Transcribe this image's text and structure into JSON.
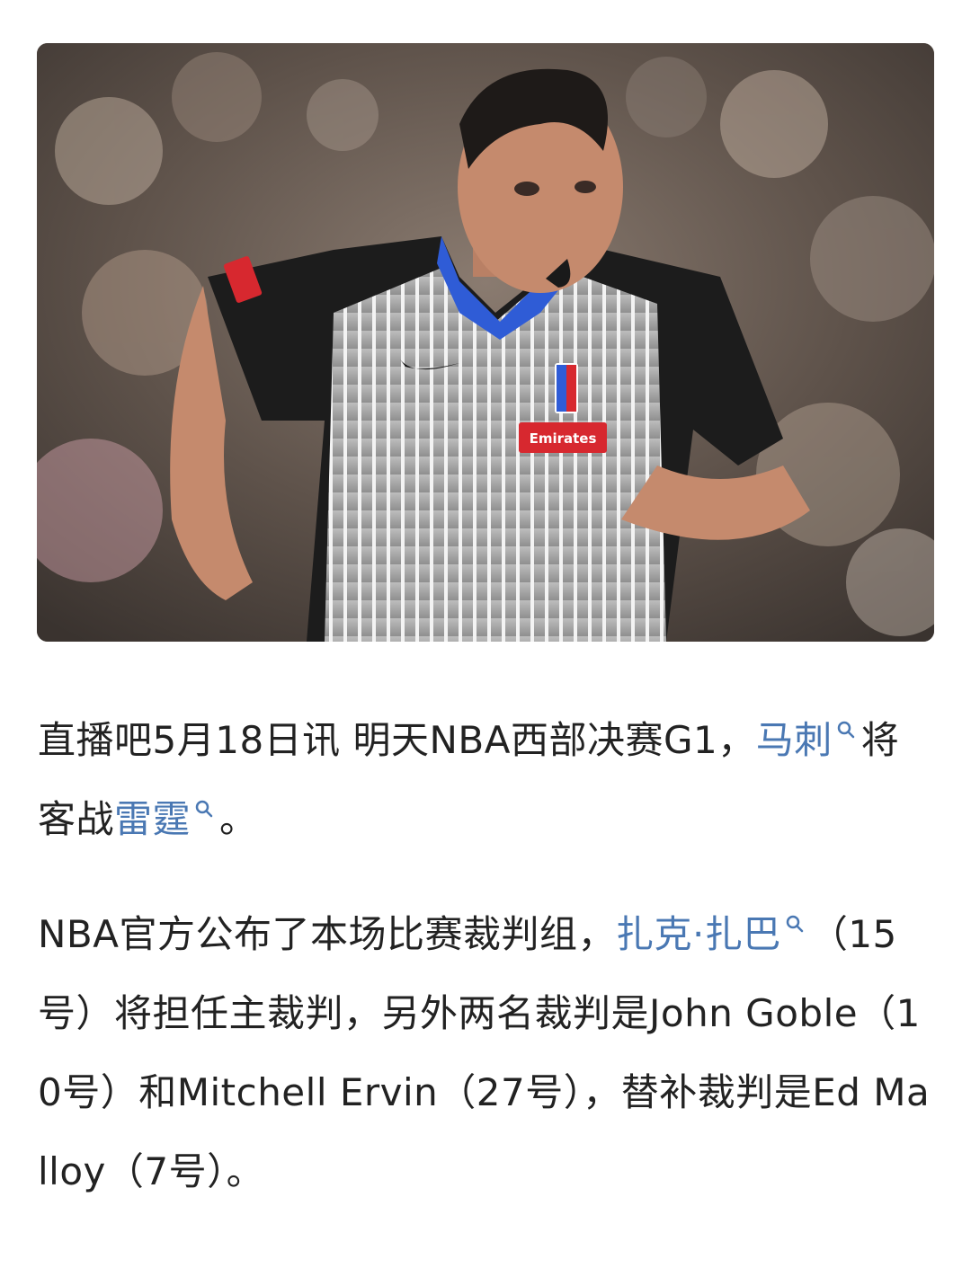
{
  "image": {
    "description_icon": "referee-photo",
    "jersey_brand": "Emirates"
  },
  "article": {
    "p1": {
      "text_before": "直播吧5月18日讯 明天NBA西部决赛G1，",
      "link1": "马刺",
      "text_mid": "将客战",
      "link2": "雷霆",
      "text_after": "。"
    },
    "p2": {
      "text_before": "NBA官方公布了本场比赛裁判组，",
      "link1": "扎克·扎巴",
      "text_after": "（15号）将担任主裁判，另外两名裁判是John Goble（10号）和Mitchell Ervin（27号），替补裁判是Ed Malloy（7号）。"
    }
  },
  "colors": {
    "link": "#4a78b3",
    "text": "#222222"
  }
}
